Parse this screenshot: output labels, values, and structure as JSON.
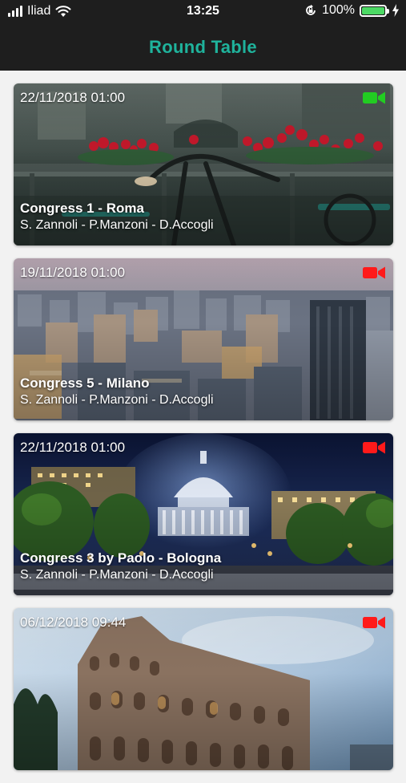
{
  "status_bar": {
    "carrier": "Iliad",
    "time": "13:25",
    "battery": "100%"
  },
  "header": {
    "title": "Round Table"
  },
  "events": [
    {
      "date": "22/11/2018 01:00",
      "title": "Congress 1 - Roma",
      "speakers": "S. Zannoli - P.Manzoni - D.Accogli",
      "camera_color": "#22cc22",
      "image": "rome-canal-bicycle"
    },
    {
      "date": "19/11/2018 01:00",
      "title": "Congress 5 - Milano",
      "speakers": "S. Zannoli - P.Manzoni - D.Accogli",
      "camera_color": "#ff1a1a",
      "image": "milan-skyline"
    },
    {
      "date": "22/11/2018 01:00",
      "title": "Congress 3 by Paolo - Bologna",
      "speakers": "S. Zannoli - P.Manzoni - D.Accogli",
      "camera_color": "#ff1a1a",
      "image": "capitol-night"
    },
    {
      "date": "06/12/2018 09:44",
      "title": "",
      "speakers": "",
      "camera_color": "#ff1a1a",
      "image": "colosseum"
    }
  ]
}
